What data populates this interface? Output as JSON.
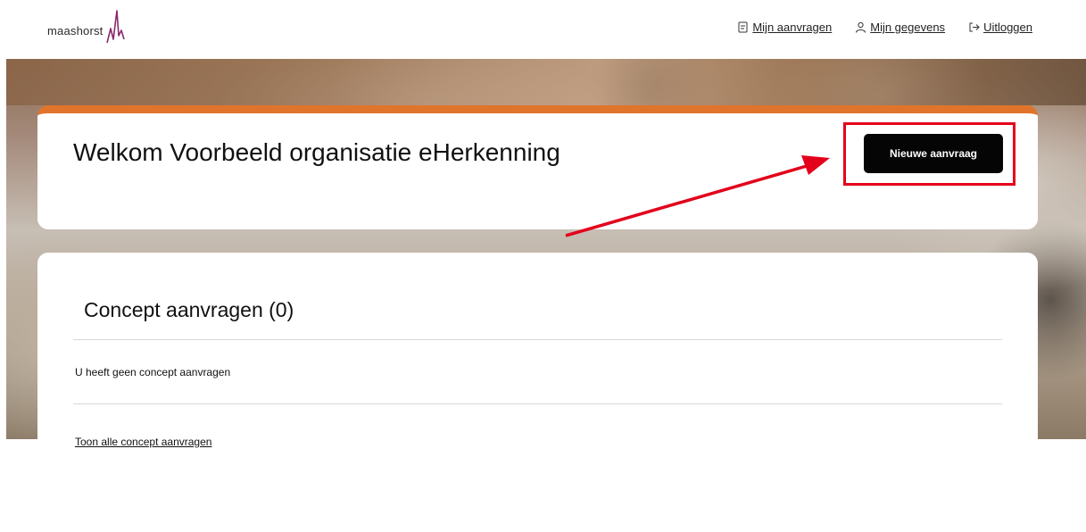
{
  "header": {
    "logo_text": "maashorst",
    "nav": [
      {
        "label": "Mijn aanvragen",
        "icon": "document-icon"
      },
      {
        "label": "Mijn gegevens",
        "icon": "user-icon"
      },
      {
        "label": "Uitloggen",
        "icon": "logout-icon"
      }
    ]
  },
  "welcome": {
    "title": "Welkom Voorbeeld organisatie eHerkenning",
    "new_button_label": "Nieuwe aanvraag"
  },
  "concepts": {
    "title": "Concept aanvragen (0)",
    "empty_message": "U heeft geen concept aanvragen",
    "show_all_link": "Toon alle concept aanvragen"
  },
  "colors": {
    "accent": "#e0742b",
    "highlight": "#e3001b",
    "button": "#050505",
    "logo": "#8a2a6e"
  }
}
